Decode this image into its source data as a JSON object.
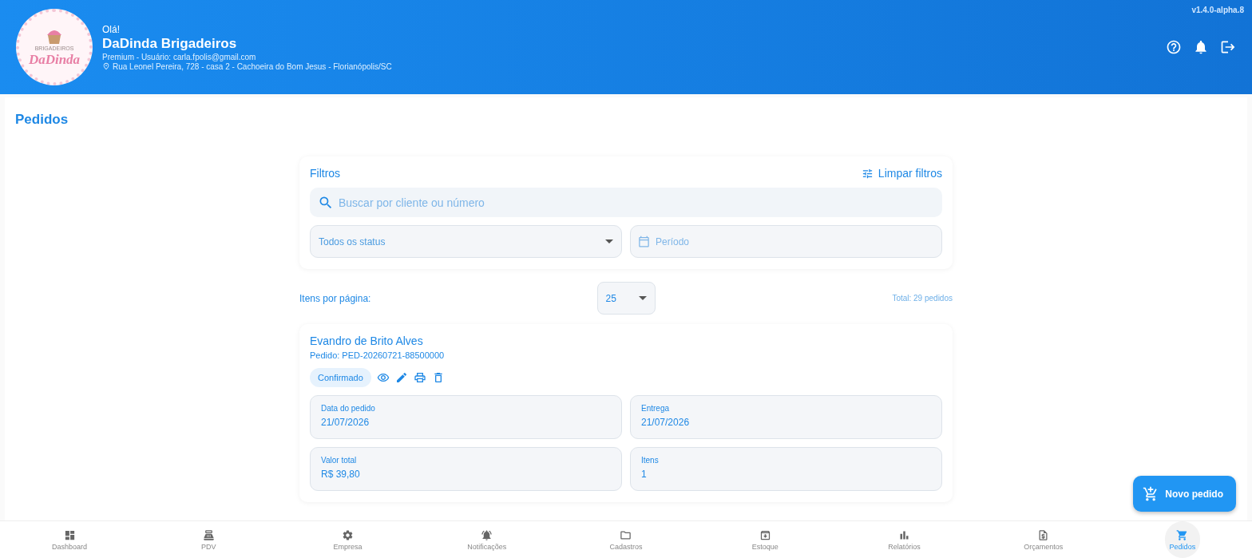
{
  "header": {
    "logo": {
      "top": "BRIGADEIROS",
      "name": "DaDinda"
    },
    "greeting": "Olá!",
    "business": "DaDinda Brigadeiros",
    "account": "Premium - Usuário: carla.fpolis@gmail.com",
    "address": "Rua Leonel Pereira, 728 - casa 2 - Cachoeira do Bom Jesus - Florianópolis/SC",
    "version": "v1.4.0-alpha.8"
  },
  "page_title": "Pedidos",
  "filters": {
    "title": "Filtros",
    "clear": "Limpar filtros",
    "search": {
      "placeholder": "Buscar por cliente ou número"
    },
    "status": {
      "value": "Todos os status"
    },
    "period": {
      "placeholder": "Período"
    }
  },
  "pagination": {
    "label": "Itens por página:",
    "per_page": "25",
    "total": "Total: 29 pedidos"
  },
  "orders": [
    {
      "customer": "Evandro de Brito Alves",
      "number": "Pedido: PED-20260721-88500000",
      "status": "Confirmado",
      "fields": [
        {
          "label": "Data do pedido",
          "value": "21/07/2026"
        },
        {
          "label": "Entrega",
          "value": "21/07/2026"
        },
        {
          "label": "Valor total",
          "value": "R$ 39,80"
        },
        {
          "label": "Itens",
          "value": "1"
        }
      ]
    }
  ],
  "fab": "Novo pedido",
  "nav": [
    {
      "kind": "dashboard",
      "label": "Dashboard",
      "selected": false
    },
    {
      "kind": "pdv",
      "label": "PDV",
      "selected": false
    },
    {
      "kind": "settings",
      "label": "Empresa",
      "selected": false
    },
    {
      "kind": "bell",
      "label": "Notificações",
      "selected": false
    },
    {
      "kind": "folder",
      "label": "Cadastros",
      "selected": false
    },
    {
      "kind": "archive",
      "label": "Estoque",
      "selected": false
    },
    {
      "kind": "chart",
      "label": "Relatórios",
      "selected": false
    },
    {
      "kind": "quote",
      "label": "Orçamentos",
      "selected": false
    },
    {
      "kind": "cart",
      "label": "Pedidos",
      "selected": true
    }
  ]
}
